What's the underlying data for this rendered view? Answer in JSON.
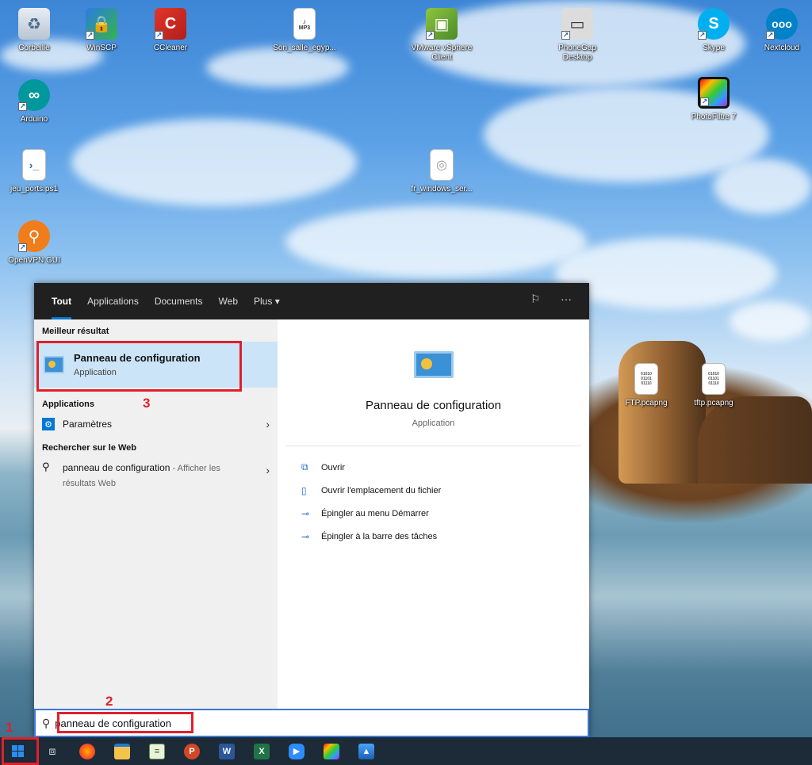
{
  "desktop": {
    "icons": [
      {
        "label": "Corbeille"
      },
      {
        "label": "WinSCP"
      },
      {
        "label": "CCleaner"
      },
      {
        "label": "Son_salle_egyp..."
      },
      {
        "label": "VMware vSphere Client"
      },
      {
        "label": "PhoneGap Desktop"
      },
      {
        "label": "Skype"
      },
      {
        "label": "Nextcloud"
      },
      {
        "label": "Arduino"
      },
      {
        "label": "PhotoFiltre 7"
      },
      {
        "label": "jeu_ports.ps1"
      },
      {
        "label": "fr_windows_ser..."
      },
      {
        "label": "OpenVPN GUI"
      },
      {
        "label": "FTP.pcapng"
      },
      {
        "label": "tftp.pcapng"
      }
    ],
    "file_badge": "MP3",
    "pcap_badge": "01010\n01101\n01110"
  },
  "search_panel": {
    "tabs": [
      "Tout",
      "Applications",
      "Documents",
      "Web",
      "Plus"
    ],
    "more_icon": "···",
    "best_result_header": "Meilleur résultat",
    "best_result": {
      "title": "Panneau de configuration",
      "subtitle": "Application"
    },
    "apps_header": "Applications",
    "apps": [
      {
        "label": "Paramètres"
      }
    ],
    "web_header": "Rechercher sur le Web",
    "web_result": {
      "query": "panneau de configuration",
      "suffix": " - Afficher les résultats Web"
    },
    "detail": {
      "title": "Panneau de configuration",
      "subtitle": "Application",
      "actions": [
        "Ouvrir",
        "Ouvrir l'emplacement du fichier",
        "Épingler au menu Démarrer",
        "Épingler à la barre des tâches"
      ]
    }
  },
  "search_box": {
    "value": "panneau de configuration"
  },
  "annotations": {
    "n1": "1",
    "n2": "2",
    "n3": "3"
  }
}
